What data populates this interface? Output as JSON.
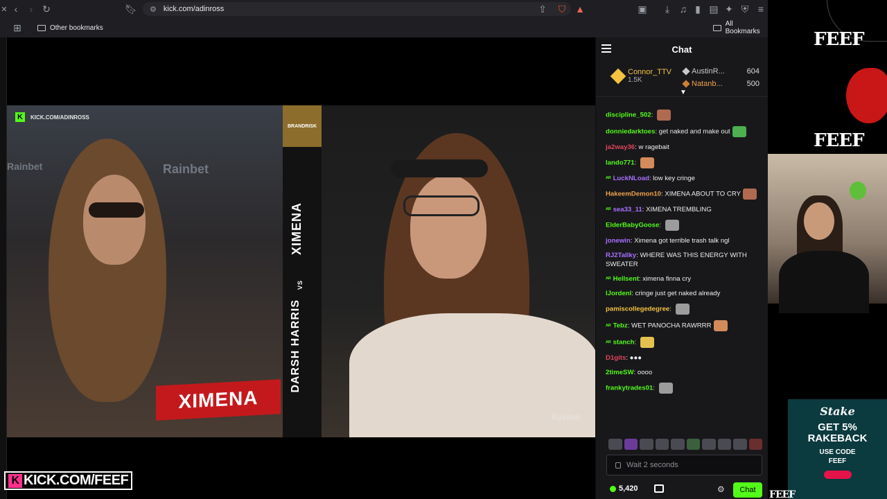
{
  "browser": {
    "url": "kick.com/adinross",
    "bookmarks": {
      "other": "Other bookmarks",
      "all": "All Bookmarks"
    }
  },
  "video": {
    "kick_tag": "KICK.COM/ADINROSS",
    "name_card": "XIMENA",
    "branding": "BRANDRISK",
    "vertical_top": "XIMENA",
    "vertical_vs": "VS",
    "vertical_bottom": "DARSH HARRIS",
    "watermark": "Rainbet",
    "sponsor_left": "Rainbet"
  },
  "overlay": {
    "tag": "KICK.COM/FEEF"
  },
  "chat": {
    "title": "Chat",
    "leaderboard": {
      "top": {
        "name": "Connor_TTV",
        "value": "1.5K"
      },
      "second": {
        "name": "AustinR...",
        "value": "604"
      },
      "third": {
        "name": "Natanb...",
        "value": "500"
      }
    },
    "messages": [
      {
        "user": "discipline_502",
        "color": "#53fc18",
        "text": "",
        "emote": true
      },
      {
        "user": "donniedarktoes",
        "color": "#53fc18",
        "text": "get naked and make out",
        "emote": true
      },
      {
        "user": "ja2way36",
        "color": "#e0455a",
        "text": "w ragebait",
        "emote": false
      },
      {
        "user": "lando771",
        "color": "#53fc18",
        "text": "",
        "emote": true
      },
      {
        "user": "LuckNLoad",
        "color": "#a970ff",
        "text": "low key cringe",
        "emote": false,
        "badge": true
      },
      {
        "user": "HakeemDemon10",
        "color": "#f0a24a",
        "text": "XIMENA ABOUT TO CRY",
        "emote": true
      },
      {
        "user": "sea33_11",
        "color": "#a970ff",
        "text": "XIMENA TREMBLING",
        "emote": false,
        "badge": true
      },
      {
        "user": "ElderBabyGoose",
        "color": "#53fc18",
        "text": "",
        "emote": true
      },
      {
        "user": "jonewin",
        "color": "#a970ff",
        "text": "Ximena got terrible trash talk ngl",
        "emote": false
      },
      {
        "user": "RJ2Tallky",
        "color": "#a970ff",
        "text": "WHERE WAS THIS ENERGY WITH SWEATER",
        "emote": false
      },
      {
        "user": "Hellsent",
        "color": "#53fc18",
        "text": "ximena finna cry",
        "emote": false,
        "badge": true
      },
      {
        "user": "lJordenl",
        "color": "#53fc18",
        "text": "cringe just get naked already",
        "emote": false
      },
      {
        "user": "pamiscollegedegree",
        "color": "#f5c242",
        "text": "",
        "emote": true
      },
      {
        "user": "Tebz",
        "color": "#53fc18",
        "text": "WET PANOCHA RAWRRR",
        "emote": true,
        "badge": true
      },
      {
        "user": "stanch",
        "color": "#53fc18",
        "text": "",
        "emote": true,
        "badge": true
      },
      {
        "user": "D1gits",
        "color": "#e0455a",
        "text": "●●●",
        "emote": false
      },
      {
        "user": "2timeSW",
        "color": "#53fc18",
        "text": "oooo",
        "emote": false
      },
      {
        "user": "frankytrades01",
        "color": "#53fc18",
        "text": "",
        "emote": true
      }
    ],
    "input_placeholder": "Wait 2 seconds",
    "points": "5,420",
    "send_label": "Chat"
  },
  "side": {
    "feef_top": "FEEF",
    "feef_mid": "FEEF",
    "feef_bottom": "FEEF",
    "ad_brand": "Stake",
    "ad_offer_line1": "GET 5%",
    "ad_offer_line2": "RAKEBACK",
    "ad_code_label": "USE CODE",
    "ad_code": "FEEF"
  }
}
